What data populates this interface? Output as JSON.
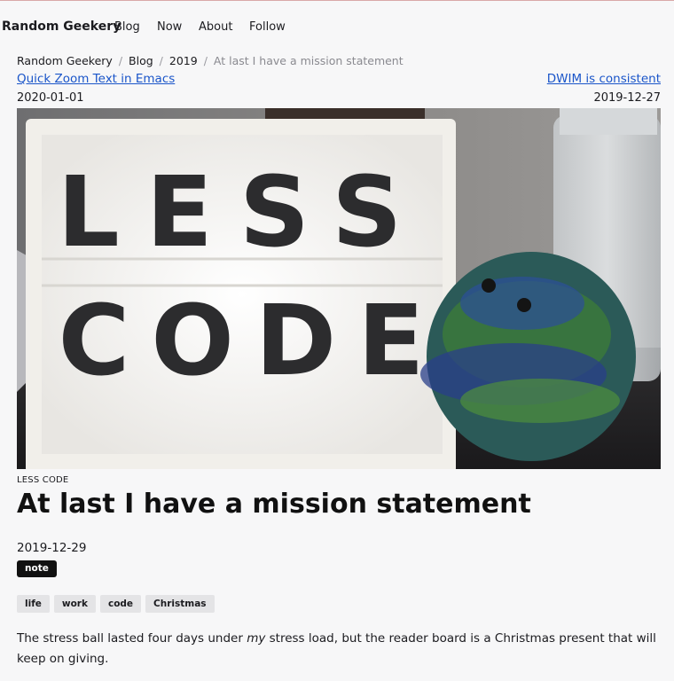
{
  "nav": {
    "brand": "Random Geekery",
    "links": [
      "Blog",
      "Now",
      "About",
      "Follow"
    ]
  },
  "breadcrumb": {
    "items": [
      "Random Geekery",
      "Blog",
      "2019"
    ],
    "current": "At last I have a mission statement"
  },
  "adjacent": {
    "prev_title": "Quick Zoom Text in Emacs",
    "prev_date": "2020-01-01",
    "next_title": "DWIM is consistent",
    "next_date": "2019-12-27"
  },
  "hero": {
    "sign_line1": "LESS",
    "sign_line2": "CODE"
  },
  "post": {
    "caption": "LESS CODE",
    "title": "At last I have a mission statement",
    "date": "2019-12-29",
    "type": "note",
    "tags": [
      "life",
      "work",
      "code",
      "Christmas"
    ],
    "body_before": "The stress ball lasted four days under ",
    "body_em": "my",
    "body_after": " stress load, but the reader board is a Christmas present that will keep on giving."
  }
}
